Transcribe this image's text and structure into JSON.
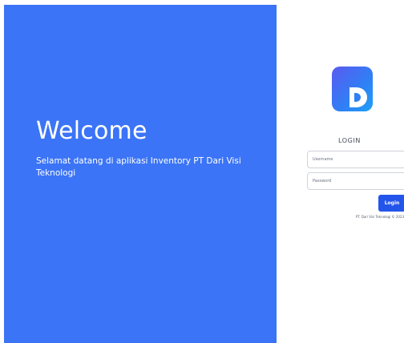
{
  "hero": {
    "title": "Welcome",
    "subtitle": "Selamat datang di aplikasi Inventory PT Dari Visi Teknologi",
    "background_color": "#3b74f6"
  },
  "login": {
    "logo_icon": "d-logo-icon",
    "title": "LOGIN",
    "username_placeholder": "Username",
    "password_placeholder": "Password",
    "button_label": "Login",
    "button_color": "#2455ea",
    "copyright": "PT. Dari Visi Teknologi © 2023"
  }
}
